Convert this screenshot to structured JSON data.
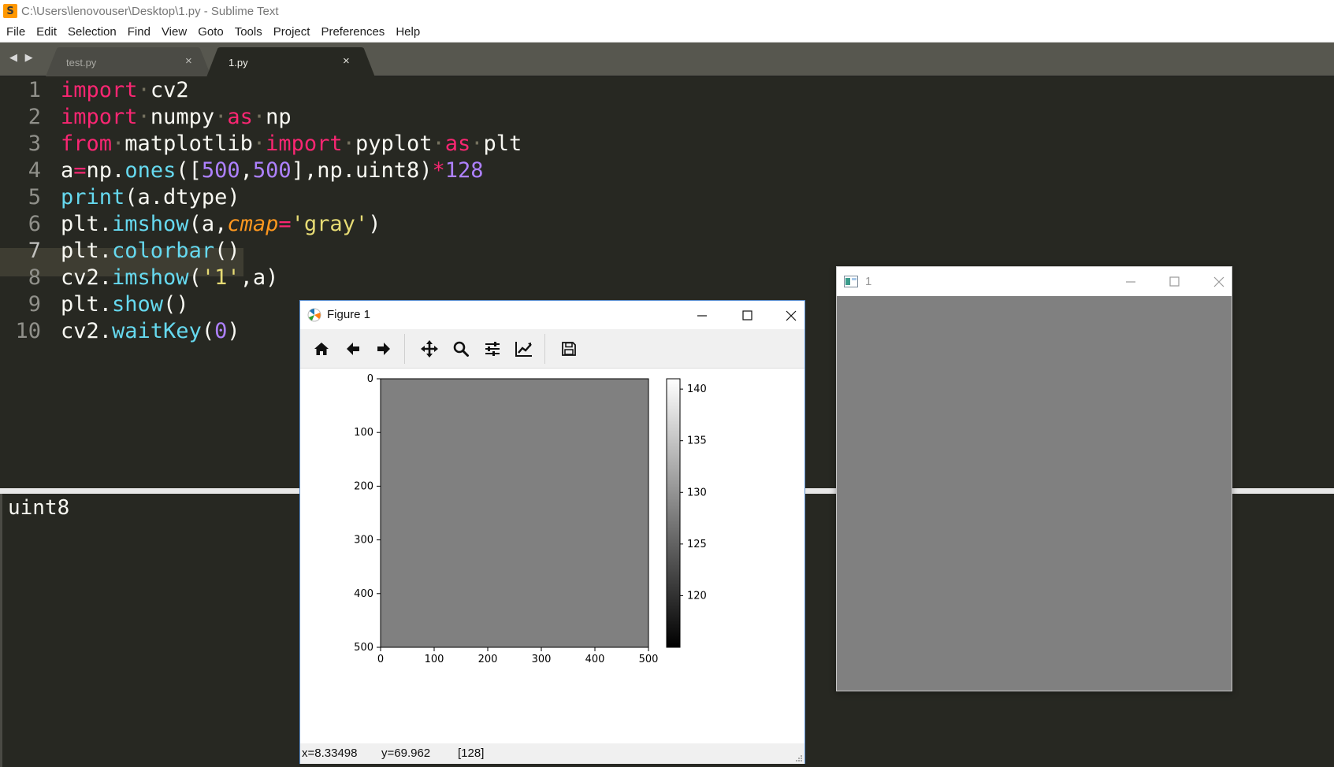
{
  "window": {
    "title": "C:\\Users\\lenovouser\\Desktop\\1.py - Sublime Text",
    "app_icon": "S"
  },
  "menu": [
    "File",
    "Edit",
    "Selection",
    "Find",
    "View",
    "Goto",
    "Tools",
    "Project",
    "Preferences",
    "Help"
  ],
  "tabs": [
    {
      "label": "test.py",
      "active": false,
      "close": "×"
    },
    {
      "label": "1.py",
      "active": true,
      "close": "×"
    }
  ],
  "tab_arrows": "◀ ▶",
  "editor": {
    "active_line": 7,
    "line_numbers": [
      "1",
      "2",
      "3",
      "4",
      "5",
      "6",
      "7",
      "8",
      "9",
      "10"
    ],
    "line4": {
      "a": "a",
      "eq": "=",
      "np": "np.",
      "ones": "ones",
      "open": "([",
      "n1": "500",
      "comma1": ",",
      "n2": "500",
      "close": "],np.uint8)",
      "star": "*",
      "n3": "128"
    },
    "tokens": {
      "import": "import",
      "from": "from",
      "as": "as",
      "cv2": "cv2",
      "numpy": "numpy",
      "np": "np",
      "matplotlib": "matplotlib",
      "pyplot": "pyplot",
      "plt": "plt",
      "dot": "·",
      "print": "print",
      "a_dtype": "(a.dtype)",
      "plt_dot": "plt.",
      "imshow": "imshow",
      "open_a": "(a,",
      "cmap": "cmap",
      "eq": "=",
      "gray": "'gray'",
      "close_paren": ")",
      "colorbar": "colorbar",
      "empty_call": "()",
      "cv2_dot": "cv2.",
      "open": "(",
      "one_str": "'1'",
      "comma_a_close": ",a)",
      "show": "show",
      "waitKey": "waitKey",
      "zero": "0"
    }
  },
  "console": {
    "output": "uint8"
  },
  "figure": {
    "title": "Figure 1",
    "toolbar": [
      "home-icon",
      "back-arrow-icon",
      "forward-arrow-icon",
      "pan-icon",
      "zoom-icon",
      "subplots-icon",
      "edit-curves-icon",
      "save-icon"
    ],
    "status": {
      "x": "x=8.33498",
      "y": "y=69.962",
      "value": "[128]"
    }
  },
  "cv_window": {
    "title": "1"
  },
  "chart_data": {
    "type": "heatmap",
    "title": "",
    "xlabel": "",
    "ylabel": "",
    "xlim": [
      0,
      500
    ],
    "ylim": [
      500,
      0
    ],
    "xticks": [
      0,
      100,
      200,
      300,
      400,
      500
    ],
    "yticks": [
      0,
      100,
      200,
      300,
      400,
      500
    ],
    "image": {
      "rows": 500,
      "cols": 500,
      "value": 128,
      "color": "#808080",
      "cmap": "gray"
    },
    "colorbar": {
      "ticks": [
        140,
        135,
        130,
        125,
        120
      ],
      "range": [
        115,
        141
      ]
    }
  }
}
